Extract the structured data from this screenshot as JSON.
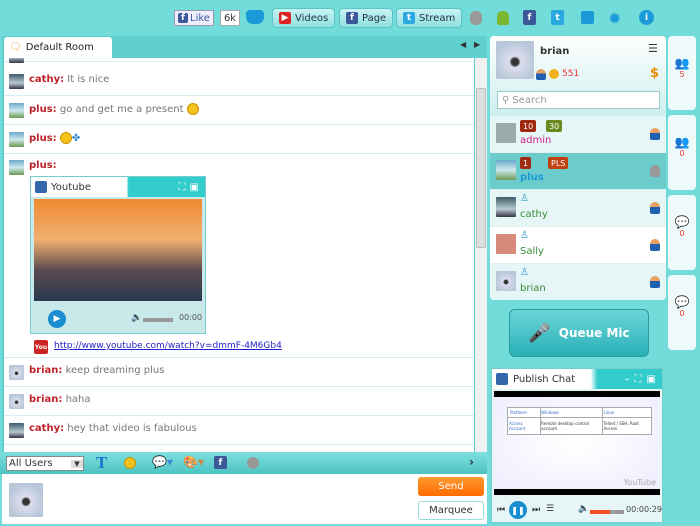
{
  "topbar": {
    "like_label": "Like",
    "like_count": "6k",
    "videos": "Videos",
    "page": "Page",
    "stream": "Stream",
    "icons": [
      "controller-icon",
      "apple-icon",
      "android-icon",
      "facebook-add-icon",
      "twitter-add-icon",
      "gift-icon",
      "gear-icon",
      "info-icon"
    ]
  },
  "room": {
    "tab": "Default Room"
  },
  "messages": [
    {
      "user": "cathy",
      "text": "It is nice"
    },
    {
      "user": "plus",
      "text": "go and get me a present"
    },
    {
      "user": "plus",
      "text": ""
    },
    {
      "user": "plus",
      "text": ""
    },
    {
      "user": "brian",
      "text": "keep dreaming plus"
    },
    {
      "user": "brian",
      "text": "haha"
    },
    {
      "user": "cathy",
      "text": "hey that video is fabulous"
    }
  ],
  "youtube": {
    "title": "Youtube",
    "time": "00:00",
    "link": "http://www.youtube.com/watch?v=dmmF-4M6Gb4"
  },
  "toolbar": {
    "recipient": "All Users"
  },
  "input": {
    "send": "Send",
    "marquee": "Marquee"
  },
  "profile": {
    "name": "brian",
    "coins": "551",
    "search_placeholder": "Search"
  },
  "users": [
    {
      "name": "admin",
      "color": "#d0208a",
      "badges": [
        "10",
        "30"
      ]
    },
    {
      "name": "plus",
      "color": "#1a9ad8",
      "badges": [
        "1",
        "PLS"
      ],
      "selected": true
    },
    {
      "name": "cathy",
      "color": "#3a8a3a"
    },
    {
      "name": "Sally",
      "color": "#3a8a3a"
    },
    {
      "name": "brian",
      "color": "#3a8a3a"
    }
  ],
  "side_tabs": [
    {
      "count": "5"
    },
    {
      "count": "0"
    },
    {
      "count": "0"
    },
    {
      "count": "0"
    }
  ],
  "queue_mic": "Queue Mic",
  "publish": {
    "title": "Publish Chat",
    "time": "00:00:29",
    "volume": 0.6,
    "table": {
      "headers": [
        "Platform",
        "Windows",
        "Linux"
      ],
      "row": [
        "Access Account",
        "Remote desktop control account",
        "Telnet / SSH, Root Access"
      ]
    }
  },
  "colors": {
    "background": "#72dcdb",
    "send": "#ff7a00",
    "name": "#c0222a"
  }
}
